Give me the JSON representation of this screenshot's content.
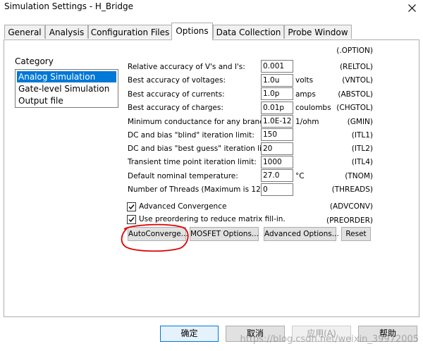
{
  "window": {
    "title": "Simulation Settings - H_Bridge"
  },
  "tabs": [
    {
      "label": "General"
    },
    {
      "label": "Analysis"
    },
    {
      "label": "Configuration Files"
    },
    {
      "label": "Options"
    },
    {
      "label": "Data Collection"
    },
    {
      "label": "Probe Window"
    }
  ],
  "active_tab": "Options",
  "category": {
    "label": "Category",
    "items": [
      "Analog Simulation",
      "Gate-level Simulation",
      "Output file"
    ],
    "selected": "Analog Simulation"
  },
  "options_header": "(.OPTION)",
  "options": [
    {
      "label": "Relative accuracy of V's and I's:",
      "value": "0.001",
      "unit": "",
      "option": "(RELTOL)"
    },
    {
      "label": "Best accuracy of voltages:",
      "value": "1.0u",
      "unit": "volts",
      "option": "(VNTOL)"
    },
    {
      "label": "Best accuracy of currents:",
      "value": "1.0p",
      "unit": "amps",
      "option": "(ABSTOL)"
    },
    {
      "label": "Best accuracy of charges:",
      "value": "0.01p",
      "unit": "coulombs",
      "option": "(CHGTOL)"
    },
    {
      "label": "Minimum conductance for any branch:",
      "value": "1.0E-12",
      "unit": "1/ohm",
      "option": "(GMIN)"
    },
    {
      "label": "DC and bias \"blind\" iteration limit:",
      "value": "150",
      "unit": "",
      "option": "(ITL1)"
    },
    {
      "label": "DC and bias \"best guess\" iteration limit:",
      "value": "20",
      "unit": "",
      "option": "(ITL2)"
    },
    {
      "label": "Transient time point iteration limit:",
      "value": "1000",
      "unit": "",
      "option": "(ITL4)"
    },
    {
      "label": "Default nominal temperature:",
      "value": "27.0",
      "unit": "°C",
      "option": "(TNOM)"
    },
    {
      "label": "Number of Threads (Maximum is 12)",
      "value": "0",
      "unit": "",
      "option": "(THREADS)"
    }
  ],
  "checkboxes": [
    {
      "label": "Advanced Convergence",
      "option": "(ADVCONV)",
      "checked": true
    },
    {
      "label": "Use preordering to reduce matrix fill-in.",
      "option": "(PREORDER)",
      "checked": true
    }
  ],
  "buttons": {
    "autoconverge": "AutoConverge...",
    "mosfet": "MOSFET Options...",
    "advanced": "Advanced Options...",
    "reset": "Reset"
  },
  "footer": {
    "ok": "确定",
    "cancel": "取消",
    "apply": "应用(A)",
    "help": "帮助"
  },
  "watermark": "https://blog.csdn.net/weixin_39972005",
  "colors": {
    "selection": "#0078d7",
    "annotation_circle": "#e00000"
  }
}
